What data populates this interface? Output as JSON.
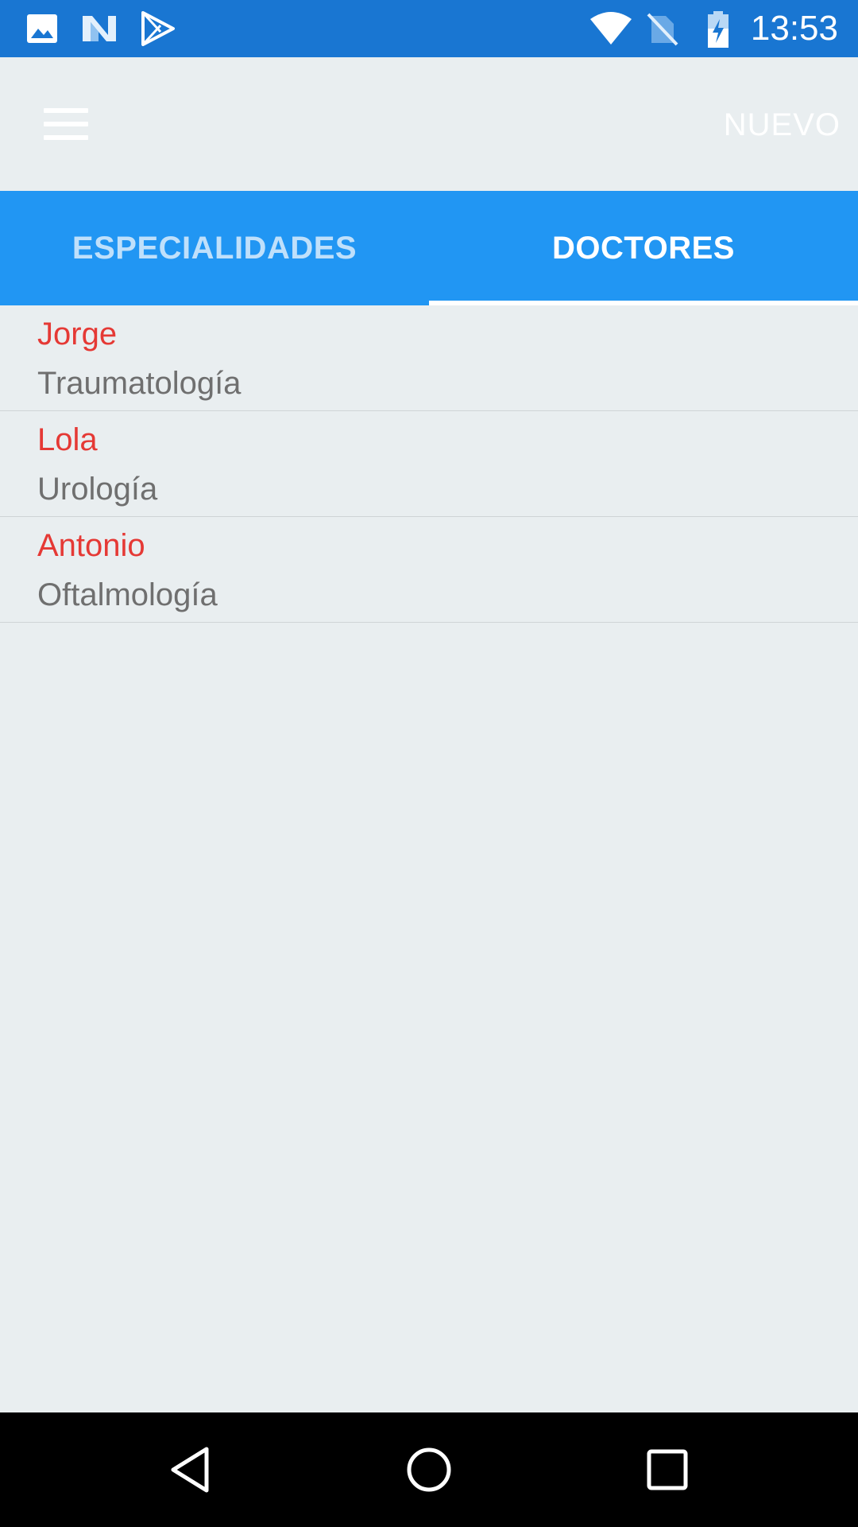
{
  "status_bar": {
    "time": "13:53",
    "left_icons": [
      "image-icon",
      "n-icon",
      "play-store-icon"
    ],
    "right_icons": [
      "wifi-icon",
      "no-sim-icon",
      "battery-charging-icon"
    ],
    "color": "#1976d2"
  },
  "toolbar": {
    "menu_icon": "hamburger-menu-icon",
    "new_label": "NUEVO"
  },
  "tabs": [
    {
      "label": "ESPECIALIDADES",
      "selected": false
    },
    {
      "label": "DOCTORES",
      "selected": true
    }
  ],
  "doctors": [
    {
      "name": "Jorge",
      "specialty": "Traumatología"
    },
    {
      "name": "Lola",
      "specialty": "Urología"
    },
    {
      "name": "Antonio",
      "specialty": "Oftalmología"
    }
  ],
  "nav_bar": {
    "buttons": [
      "back-icon",
      "home-icon",
      "recents-icon"
    ]
  },
  "colors": {
    "tab_bar": "#2196f3",
    "name_text": "#e53935",
    "specialty_text": "#6f6f6f",
    "background": "#e9eef0"
  }
}
